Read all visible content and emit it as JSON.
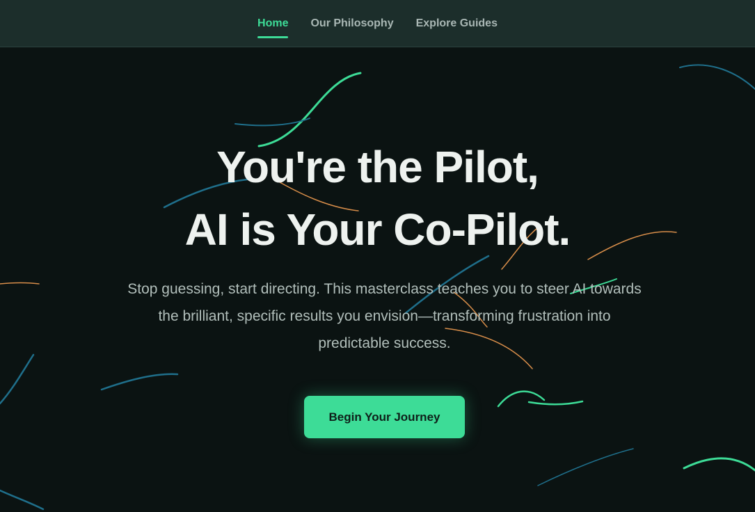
{
  "nav": {
    "items": [
      {
        "label": "Home",
        "active": true
      },
      {
        "label": "Our Philosophy",
        "active": false
      },
      {
        "label": "Explore Guides",
        "active": false
      }
    ]
  },
  "hero": {
    "headline_line1": "You're the Pilot,",
    "headline_line2": "AI is Your Co-Pilot.",
    "subtext": "Stop guessing, start directing. This masterclass teaches you to steer AI towards the brilliant, specific results you envision—transforming frustration into predictable success.",
    "cta_label": "Begin Your Journey"
  },
  "colors": {
    "accent": "#3ddc97",
    "background": "#0b1312",
    "nav_background": "#1c2e2b",
    "headline": "#eef2ef",
    "body_text": "#b2bfbb",
    "streak_blue": "#1f6f8b",
    "streak_orange": "#d98e4a"
  }
}
